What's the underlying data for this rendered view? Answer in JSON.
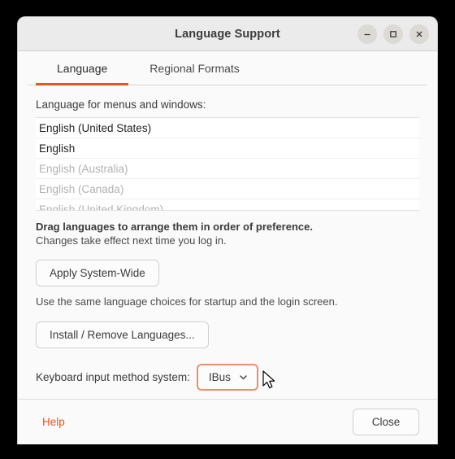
{
  "window": {
    "title": "Language Support",
    "controls": [
      {
        "name": "minimize",
        "icon": "minimize-icon"
      },
      {
        "name": "maximize",
        "icon": "maximize-icon"
      },
      {
        "name": "close",
        "icon": "close-icon"
      }
    ]
  },
  "tabs": [
    {
      "label": "Language",
      "active": true
    },
    {
      "label": "Regional Formats",
      "active": false
    }
  ],
  "language_panel": {
    "list_label": "Language for menus and windows:",
    "languages": [
      {
        "label": "English (United States)",
        "enabled": true
      },
      {
        "label": "English",
        "enabled": true
      },
      {
        "label": "English (Australia)",
        "enabled": false
      },
      {
        "label": "English (Canada)",
        "enabled": false
      },
      {
        "label": "English (United Kingdom)",
        "enabled": false
      }
    ],
    "drag_hint": "Drag languages to arrange them in order of preference.",
    "changes_hint": "Changes take effect next time you log in.",
    "apply_button": "Apply System-Wide",
    "apply_helper": "Use the same language choices for startup and the login screen.",
    "install_button": "Install / Remove Languages...",
    "input_method_label": "Keyboard input method system:",
    "input_method_value": "IBus"
  },
  "footer": {
    "help_label": "Help",
    "close_label": "Close"
  },
  "colors": {
    "accent": "#e95420",
    "focus_ring": "#e9906d",
    "titlebar": "#ebebeb",
    "content_bg": "#fafafa",
    "list_bg": "#ffffff",
    "text": "#3b3b3b",
    "disabled_text": "#b4b2b0"
  }
}
